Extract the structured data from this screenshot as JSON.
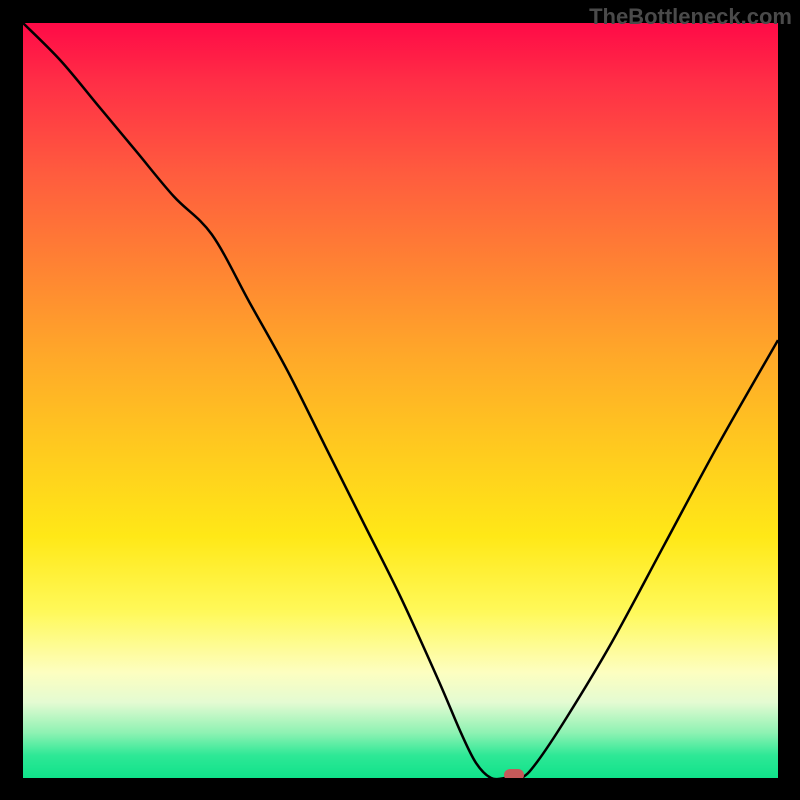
{
  "watermark": "TheBottleneck.com",
  "chart_data": {
    "type": "line",
    "title": "",
    "xlabel": "",
    "ylabel": "",
    "x_range": [
      0,
      100
    ],
    "y_range": [
      0,
      100
    ],
    "series": [
      {
        "name": "bottleneck-curve",
        "x": [
          0,
          5,
          10,
          15,
          20,
          25,
          30,
          35,
          40,
          45,
          50,
          55,
          58,
          60,
          62,
          64,
          66,
          68,
          72,
          78,
          85,
          92,
          100
        ],
        "y": [
          100,
          95,
          89,
          83,
          77,
          72,
          63,
          54,
          44,
          34,
          24,
          13,
          6,
          2,
          0,
          0,
          0,
          2,
          8,
          18,
          31,
          44,
          58
        ]
      }
    ],
    "marker": {
      "x": 65,
      "y": 0,
      "label": "optimal-point"
    },
    "background": {
      "type": "vertical-gradient",
      "stops": [
        {
          "pct": 0,
          "color": "#ff0a47"
        },
        {
          "pct": 20,
          "color": "#ff5c3e"
        },
        {
          "pct": 44,
          "color": "#ffa829"
        },
        {
          "pct": 68,
          "color": "#ffe817"
        },
        {
          "pct": 86,
          "color": "#fdfec0"
        },
        {
          "pct": 100,
          "color": "#10e28a"
        }
      ]
    }
  }
}
